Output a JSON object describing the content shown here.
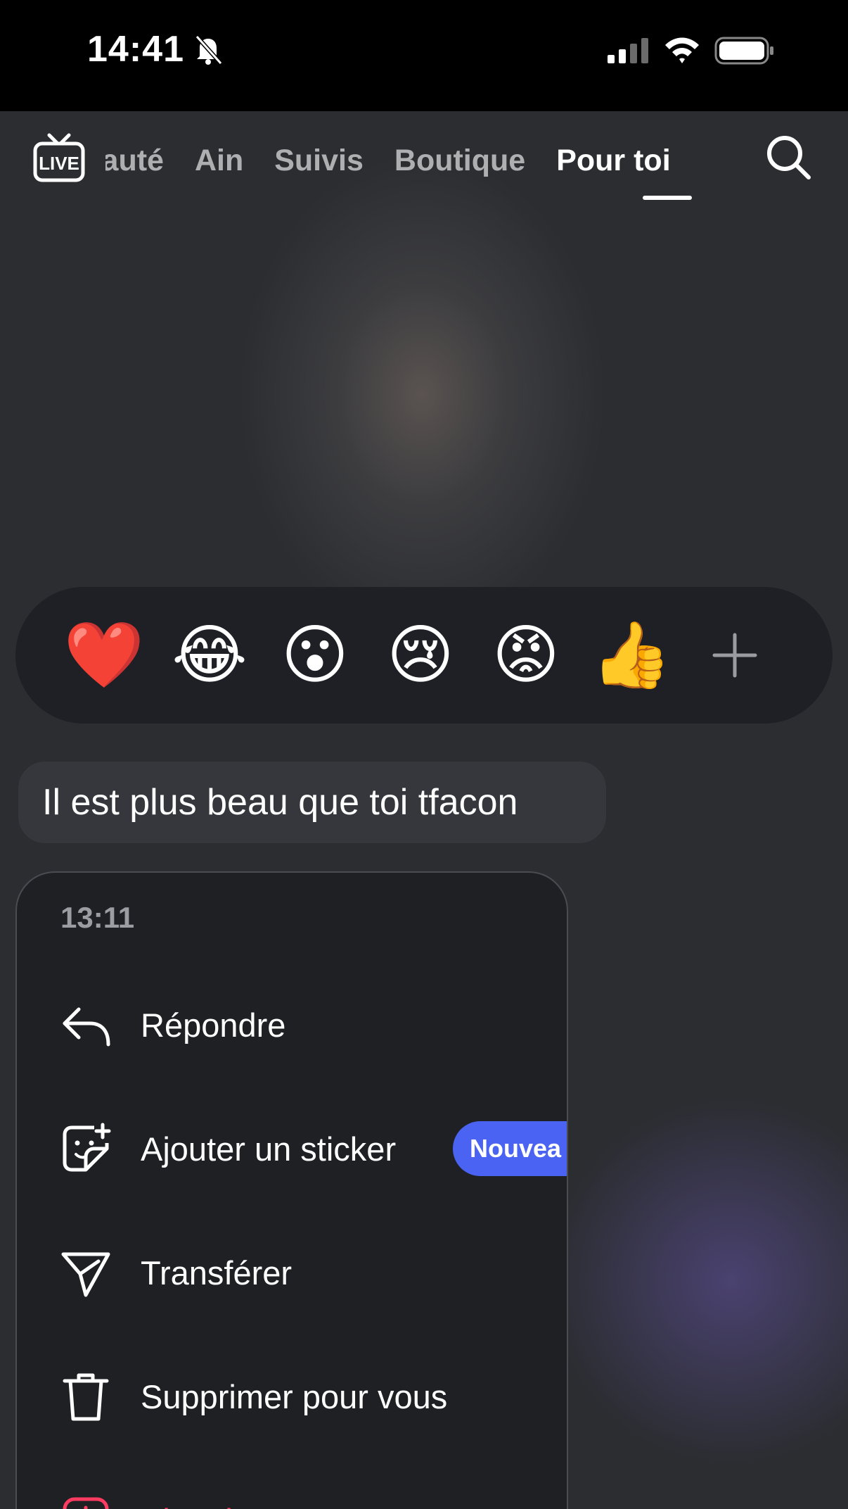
{
  "status_bar": {
    "time": "14:41",
    "icons": [
      "bell-slash-icon",
      "cellular-signal-icon",
      "wifi-icon",
      "battery-icon"
    ]
  },
  "top_nav": {
    "live_label": "LIVE",
    "tabs": [
      {
        "label": "unauté",
        "active": false
      },
      {
        "label": "Ain",
        "active": false
      },
      {
        "label": "Suivis",
        "active": false
      },
      {
        "label": "Boutique",
        "active": false
      },
      {
        "label": "Pour toi",
        "active": true
      }
    ],
    "search_icon": "search-icon"
  },
  "reactions": {
    "emojis": [
      "❤️",
      "😂",
      "😮",
      "😢",
      "😡",
      "👍"
    ],
    "more_icon": "plus-icon"
  },
  "message": {
    "text": "Il est plus beau que toi tfacon"
  },
  "context_menu": {
    "time": "13:11",
    "items": [
      {
        "label": "Répondre",
        "icon": "reply-icon"
      },
      {
        "label": "Ajouter un sticker",
        "icon": "sticker-icon",
        "badge": "Nouvea"
      },
      {
        "label": "Transférer",
        "icon": "send-icon"
      },
      {
        "label": "Supprimer pour vous",
        "icon": "trash-icon"
      },
      {
        "label": "Signaler",
        "icon": "report-icon"
      }
    ]
  },
  "colors": {
    "accent_badge": "#4b63f2",
    "report_red": "#ff3b62",
    "menu_bg": "#1f2024"
  }
}
